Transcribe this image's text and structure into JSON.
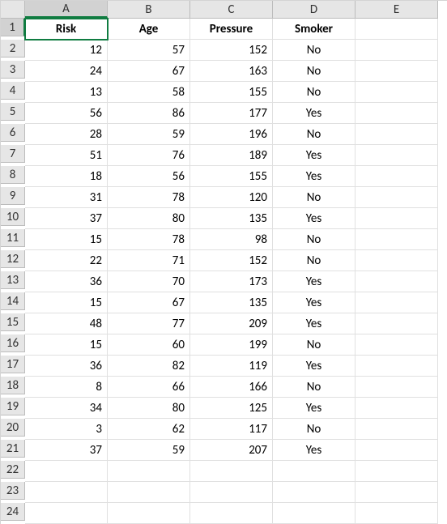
{
  "columns": [
    "A",
    "B",
    "C",
    "D",
    "E"
  ],
  "row_count": 24,
  "selected": {
    "row": 1,
    "col": "A"
  },
  "headers": [
    "Risk",
    "Age",
    "Pressure",
    "Smoker"
  ],
  "rows": [
    {
      "risk": 12,
      "age": 57,
      "pressure": 152,
      "smoker": "No"
    },
    {
      "risk": 24,
      "age": 67,
      "pressure": 163,
      "smoker": "No"
    },
    {
      "risk": 13,
      "age": 58,
      "pressure": 155,
      "smoker": "No"
    },
    {
      "risk": 56,
      "age": 86,
      "pressure": 177,
      "smoker": "Yes"
    },
    {
      "risk": 28,
      "age": 59,
      "pressure": 196,
      "smoker": "No"
    },
    {
      "risk": 51,
      "age": 76,
      "pressure": 189,
      "smoker": "Yes"
    },
    {
      "risk": 18,
      "age": 56,
      "pressure": 155,
      "smoker": "Yes"
    },
    {
      "risk": 31,
      "age": 78,
      "pressure": 120,
      "smoker": "No"
    },
    {
      "risk": 37,
      "age": 80,
      "pressure": 135,
      "smoker": "Yes"
    },
    {
      "risk": 15,
      "age": 78,
      "pressure": 98,
      "smoker": "No"
    },
    {
      "risk": 22,
      "age": 71,
      "pressure": 152,
      "smoker": "No"
    },
    {
      "risk": 36,
      "age": 70,
      "pressure": 173,
      "smoker": "Yes"
    },
    {
      "risk": 15,
      "age": 67,
      "pressure": 135,
      "smoker": "Yes"
    },
    {
      "risk": 48,
      "age": 77,
      "pressure": 209,
      "smoker": "Yes"
    },
    {
      "risk": 15,
      "age": 60,
      "pressure": 199,
      "smoker": "No"
    },
    {
      "risk": 36,
      "age": 82,
      "pressure": 119,
      "smoker": "Yes"
    },
    {
      "risk": 8,
      "age": 66,
      "pressure": 166,
      "smoker": "No"
    },
    {
      "risk": 34,
      "age": 80,
      "pressure": 125,
      "smoker": "Yes"
    },
    {
      "risk": 3,
      "age": 62,
      "pressure": 117,
      "smoker": "No"
    },
    {
      "risk": 37,
      "age": 59,
      "pressure": 207,
      "smoker": "Yes"
    }
  ]
}
